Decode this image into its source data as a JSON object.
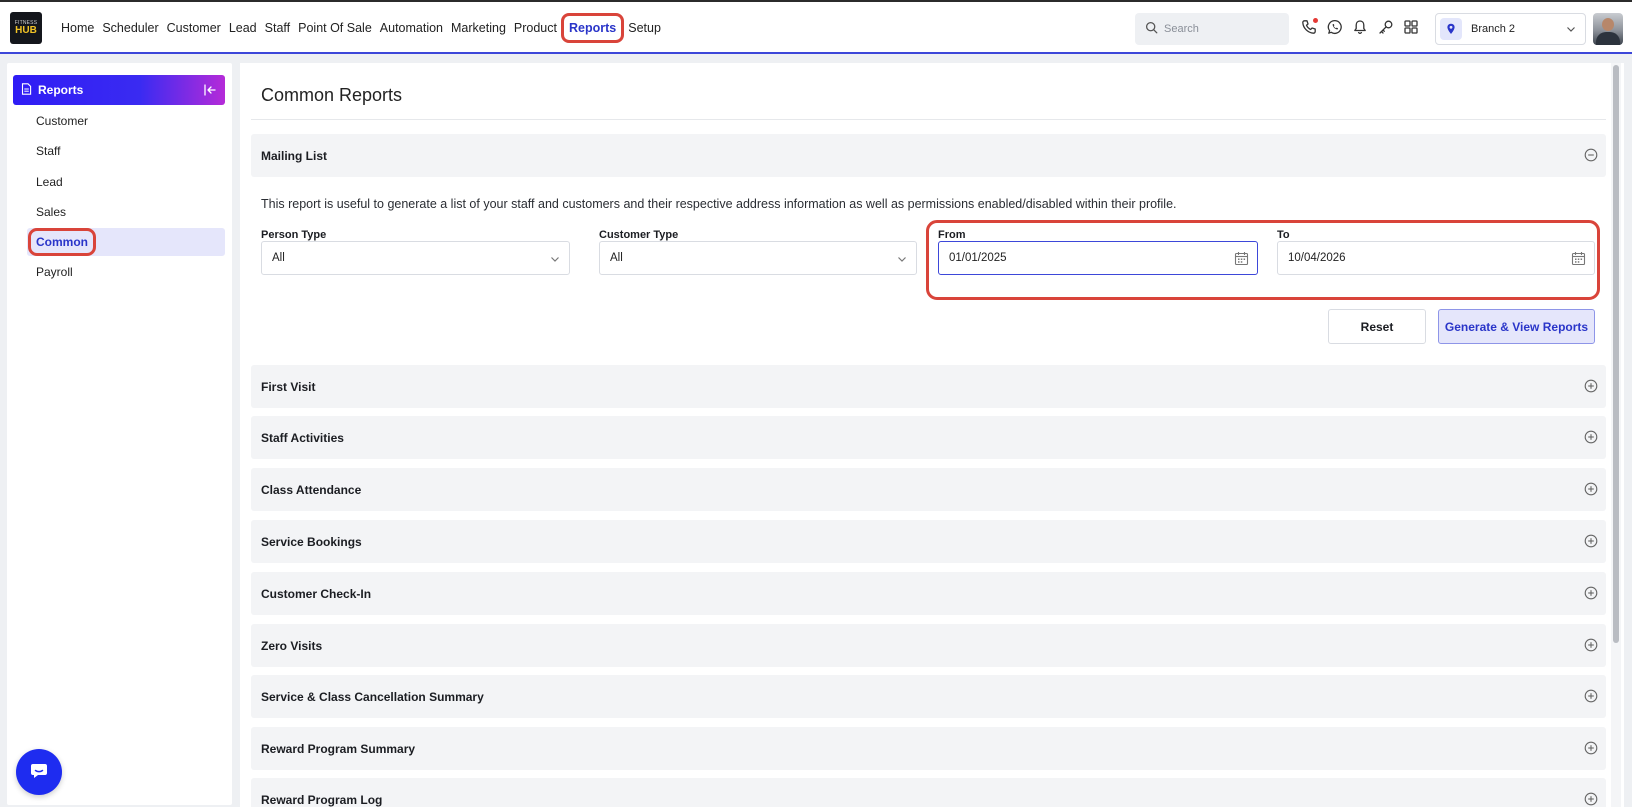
{
  "app": {
    "logo_line1": "FITNESS",
    "logo_line2": "HUB"
  },
  "nav": {
    "items": [
      {
        "label": "Home"
      },
      {
        "label": "Scheduler"
      },
      {
        "label": "Customer"
      },
      {
        "label": "Lead"
      },
      {
        "label": "Staff"
      },
      {
        "label": "Point Of Sale"
      },
      {
        "label": "Automation"
      },
      {
        "label": "Marketing"
      },
      {
        "label": "Product"
      },
      {
        "label": "Reports",
        "active": true
      },
      {
        "label": "Setup"
      }
    ]
  },
  "search": {
    "placeholder": "Search"
  },
  "top_icons": [
    "phone-icon",
    "whatsapp-icon",
    "bell-icon",
    "key-icon",
    "apps-grid-icon"
  ],
  "branch": {
    "label": "Branch 2"
  },
  "sidebar": {
    "title": "Reports",
    "items": [
      {
        "label": "Customer"
      },
      {
        "label": "Staff"
      },
      {
        "label": "Lead"
      },
      {
        "label": "Sales"
      },
      {
        "label": "Common",
        "active": true
      },
      {
        "label": "Payroll"
      }
    ]
  },
  "main": {
    "title": "Common Reports",
    "mailing_list": {
      "title": "Mailing List",
      "description": "This report is useful to generate a list of your staff and customers and their respective address information as well as permissions enabled/disabled within their profile.",
      "person_type": {
        "label": "Person Type",
        "value": "All"
      },
      "customer_type": {
        "label": "Customer Type",
        "value": "All"
      },
      "from": {
        "label": "From",
        "value": "01/01/2025"
      },
      "to": {
        "label": "To",
        "value": "10/04/2026"
      },
      "reset_label": "Reset",
      "generate_label": "Generate & View Reports"
    },
    "sections": [
      {
        "title": "First Visit"
      },
      {
        "title": "Staff Activities"
      },
      {
        "title": "Class Attendance"
      },
      {
        "title": "Service Bookings"
      },
      {
        "title": "Customer Check-In"
      },
      {
        "title": "Zero Visits"
      },
      {
        "title": "Service & Class Cancellation Summary"
      },
      {
        "title": "Reward Program Summary"
      },
      {
        "title": "Reward Program Log"
      }
    ]
  },
  "colors": {
    "accent": "#2a35c9",
    "highlight": "#d9443a",
    "sidebar_gradient_start": "#2f1cf5",
    "sidebar_gradient_end": "#b52bd8"
  }
}
